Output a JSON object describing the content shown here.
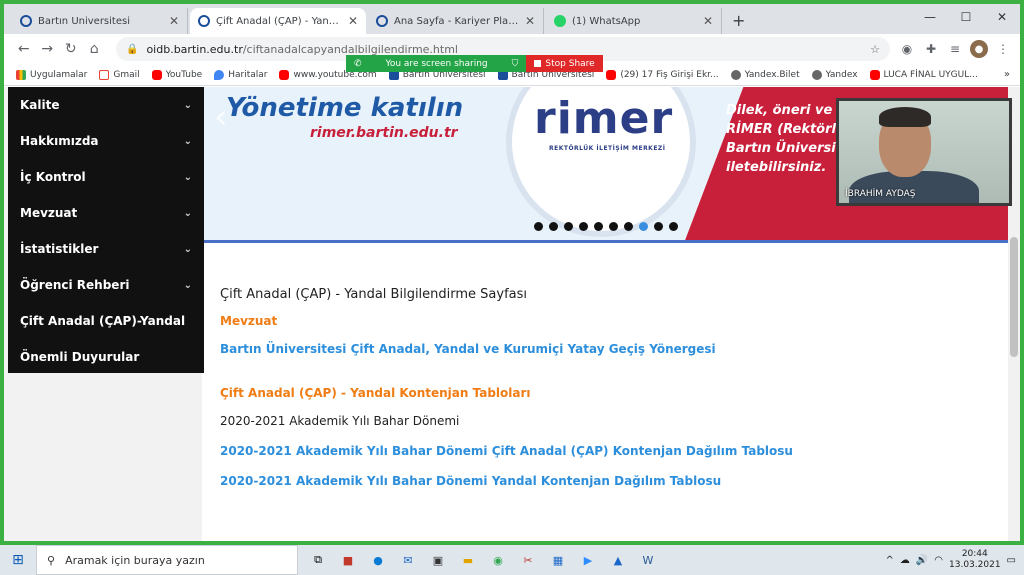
{
  "tabs": [
    {
      "title": "Bartın Üniversitesi",
      "active": false
    },
    {
      "title": "Çift Anadal (ÇAP) - Yandal Bilgile",
      "active": true
    },
    {
      "title": "Ana Sayfa - Kariyer Planlama Uyg",
      "active": false
    },
    {
      "title": "(1) WhatsApp",
      "active": false
    }
  ],
  "address": {
    "host": "oidb.bartin.edu.tr",
    "path": "/ciftanadalcapyandalbilgilendirme.html"
  },
  "bookmarks": [
    {
      "label": "Uygulamalar",
      "icon": "grid"
    },
    {
      "label": "Gmail",
      "icon": "gm"
    },
    {
      "label": "YouTube",
      "icon": "yt"
    },
    {
      "label": "Haritalar",
      "icon": "map"
    },
    {
      "label": "www.youtube.com",
      "icon": "yt"
    },
    {
      "label": "Bartın Üniversitesi",
      "icon": "bu"
    },
    {
      "label": "Bartın Üniversitesi",
      "icon": "bu"
    },
    {
      "label": "(29) 17 Fiş Girişi Ekr...",
      "icon": "yt"
    },
    {
      "label": "Yandex.Bilet",
      "icon": "globe"
    },
    {
      "label": "Yandex",
      "icon": "globe"
    },
    {
      "label": "LUCA FİNAL UYGUL...",
      "icon": "yt"
    }
  ],
  "share": {
    "status": "You are screen sharing",
    "stop": "Stop Share"
  },
  "sidebar": {
    "items": [
      {
        "label": "Kalite",
        "chev": "⌄"
      },
      {
        "label": "Hakkımızda",
        "chev": "⌄"
      },
      {
        "label": "İç Kontrol",
        "chev": "⌄"
      },
      {
        "label": "Mevzuat",
        "chev": "⌄"
      },
      {
        "label": "İstatistikler",
        "chev": "⌄"
      },
      {
        "label": "Öğrenci Rehberi",
        "chev": "⌄"
      },
      {
        "label": "Çift Anadal (ÇAP)-Yandal",
        "chev": ""
      },
      {
        "label": "Önemli Duyurular",
        "chev": ""
      }
    ]
  },
  "banner": {
    "title": "Yönetime katılın",
    "url": "rimer.bartin.edu.tr",
    "logo": "rimer",
    "logo_sub": "REKTÖRLÜK İLETİŞİM MERKEZİ",
    "right_lines": [
      "Dilek, öneri ve ş",
      "RİMER (Rektörlü",
      "Bartın Üniversit",
      "iletebilirsiniz."
    ],
    "slide_count": 10,
    "active_slide": 8
  },
  "content": {
    "heading": "Çift Anadal (ÇAP) - Yandal Bilgilendirme Sayfası",
    "section1": "Mevzuat",
    "link1": "Bartın Üniversitesi Çift Anadal, Yandal ve Kurumiçi Yatay Geçiş Yönergesi",
    "section2": "Çift Anadal (ÇAP) - Yandal Kontenjan Tabloları",
    "term": "2020-2021 Akademik Yılı Bahar Dönemi",
    "link2": "2020-2021 Akademik Yılı Bahar Dönemi Çift Anadal (ÇAP) Kontenjan Dağılım Tablosu",
    "link3": "2020-2021 Akademik Yılı Bahar Dönemi Yandal Kontenjan Dağılım Tablosu"
  },
  "webcam": {
    "name": "İBRAHİM AYDAŞ"
  },
  "taskbar": {
    "search_placeholder": "Aramak için buraya yazın",
    "time": "20:44",
    "date": "13.03.2021"
  }
}
